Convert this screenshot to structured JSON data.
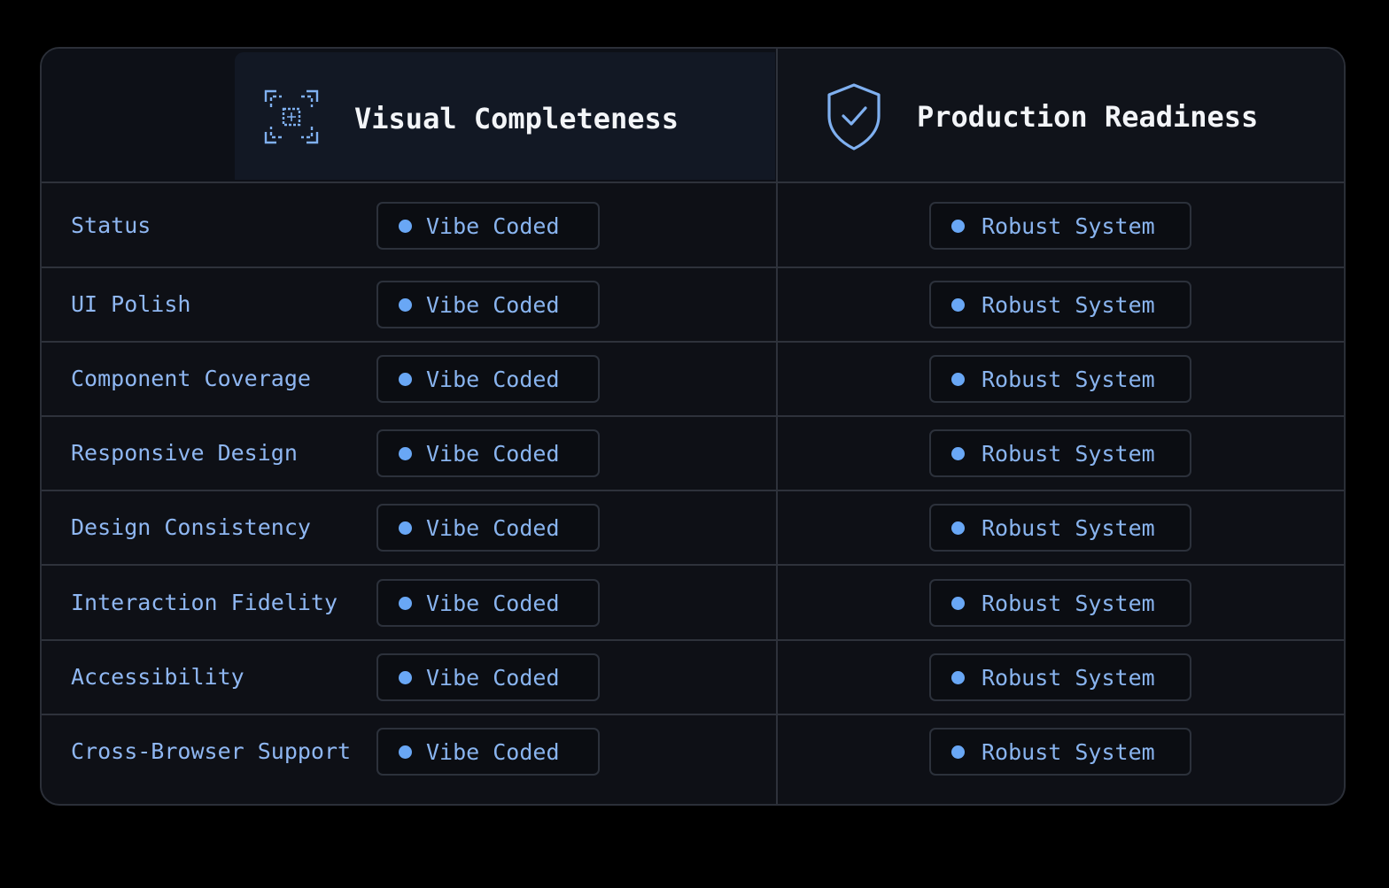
{
  "header": {
    "left": {
      "title": "Visual Completeness",
      "icon": "frame-scan-icon"
    },
    "right": {
      "title": "Production Readiness",
      "icon": "shield-check-icon"
    }
  },
  "colors": {
    "accent": "#69a7f5",
    "label_text": "#8fb7f2",
    "background": "#0e1016",
    "border": "#2e323b"
  },
  "rows": [
    {
      "label": "Status",
      "left_badge": "Vibe Coded",
      "right_badge": "Robust System"
    },
    {
      "label": "UI Polish",
      "left_badge": "Vibe Coded",
      "right_badge": "Robust System"
    },
    {
      "label": "Component Coverage",
      "left_badge": "Vibe Coded",
      "right_badge": "Robust System"
    },
    {
      "label": "Responsive Design",
      "left_badge": "Vibe Coded",
      "right_badge": "Robust System"
    },
    {
      "label": "Design Consistency",
      "left_badge": "Vibe Coded",
      "right_badge": "Robust System"
    },
    {
      "label": "Interaction Fidelity",
      "left_badge": "Vibe Coded",
      "right_badge": "Robust System"
    },
    {
      "label": "Accessibility",
      "left_badge": "Vibe Coded",
      "right_badge": "Robust System"
    },
    {
      "label": "Cross-Browser Support",
      "left_badge": "Vibe Coded",
      "right_badge": "Robust System"
    }
  ]
}
